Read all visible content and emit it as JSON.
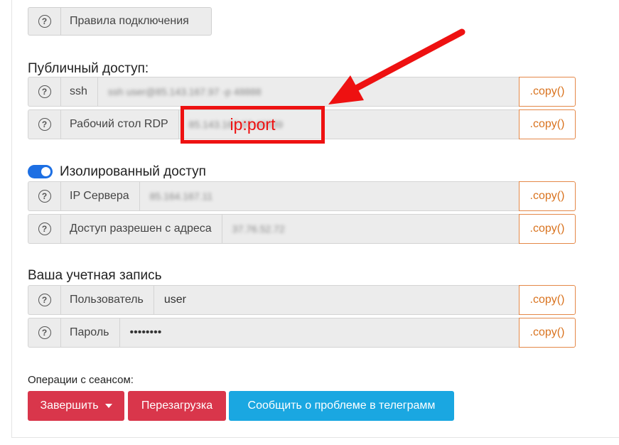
{
  "rules": {
    "label": "Правила подключения"
  },
  "public_access": {
    "title": "Публичный доступ:",
    "rows": [
      {
        "label": "ssh",
        "value": "ssh user@85.143.167.97 -p 48888",
        "copy": ".copy()"
      },
      {
        "label": "Рабочий стол RDP",
        "value": "85.143.167.97:48339",
        "copy": ".copy()"
      }
    ]
  },
  "isolated_access": {
    "title": "Изолированный доступ",
    "enabled": true,
    "rows": [
      {
        "label": "IP Сервера",
        "value": "85.164.167.11",
        "copy": ".copy()"
      },
      {
        "label": "Доступ разрешен с адреса",
        "value": "37.76.52.72",
        "copy": ".copy()"
      }
    ]
  },
  "account": {
    "title": "Ваша учетная запись",
    "rows": [
      {
        "label": "Пользователь",
        "value": "user",
        "copy": ".copy()"
      },
      {
        "label": "Пароль",
        "value": "••••••••",
        "copy": ".copy()"
      }
    ]
  },
  "session": {
    "label": "Операции с сеансом:",
    "buttons": {
      "finish": "Завершить",
      "reboot": "Перезагрузка",
      "report": "Сообщить о проблеме в телеграмм"
    }
  },
  "annotation": {
    "text": "ip:port",
    "color": "#ee1111"
  },
  "colors": {
    "toggle_on": "#1d6fe3",
    "copy_accent": "#d9731f",
    "danger": "#d9364b",
    "info": "#1aa7e1"
  }
}
